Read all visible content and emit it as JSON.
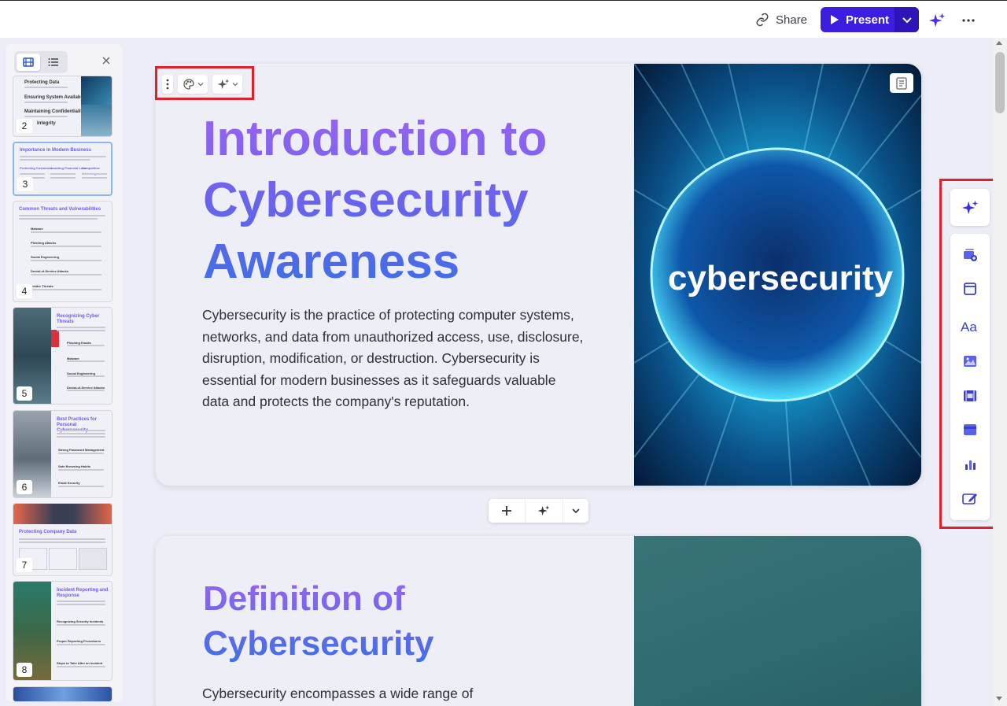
{
  "topbar": {
    "share_label": "Share",
    "present_label": "Present",
    "icons": [
      "link-icon",
      "play-icon",
      "chevron-down-icon",
      "sparkle-icon",
      "more-horizontal-icon"
    ]
  },
  "colors": {
    "accent": "#3b1ee0",
    "heading_gradient_start": "#9a63f2",
    "heading_gradient_end": "#3d6fe6",
    "highlight_box": "#e0202a"
  },
  "left_panel": {
    "views": [
      "filmstrip-view",
      "outline-view"
    ],
    "active_view": "filmstrip-view",
    "slides": [
      {
        "number": "2",
        "title": "",
        "items": [
          "Protecting Data",
          "Ensuring System Availability",
          "Maintaining Confidentiality",
          "Integrity"
        ]
      },
      {
        "number": "3",
        "title": "Importance in Modern Business",
        "columns": [
          "Protecting Customers",
          "Avoiding Financial Loss",
          "Competitive Advantage"
        ],
        "selected": true
      },
      {
        "number": "4",
        "title": "Common Threats and Vulnerabilities",
        "items": [
          "Malware",
          "Phishing Attacks",
          "Social Engineering",
          "Denial-of-Service Attacks",
          "Insider Threats"
        ]
      },
      {
        "number": "5",
        "title": "Recognizing Cyber Threats",
        "items": [
          "Phishing Emails",
          "Malware",
          "Social Engineering",
          "Denial-of-Service Attacks"
        ]
      },
      {
        "number": "6",
        "title": "Best Practices for Personal Cybersecurity",
        "items": [
          "Strong Password Management",
          "Safe Browsing Habits",
          "Email Security"
        ]
      },
      {
        "number": "7",
        "title": "Protecting Company Data"
      },
      {
        "number": "8",
        "title": "Incident Reporting and Response",
        "items": [
          "Recognizing Security Incidents",
          "Proper Reporting Procedures",
          "Steps to Take After an Incident"
        ]
      }
    ]
  },
  "card1": {
    "toolbar_icons": [
      "more-vertical-icon",
      "palette-icon",
      "sparkle-icon"
    ],
    "heading": "Introduction to Cybersecurity Awareness",
    "body": "Cybersecurity is the practice of protecting computer systems, networks, and data from unauthorized access, use, disclosure, disruption, modification, or destruction. Cybersecurity is essential for modern businesses as it safeguards valuable data and protects the company's reputation.",
    "image_text": "cybersecurity"
  },
  "add_bar": {
    "icons": [
      "plus-icon",
      "sparkle-icon",
      "chevron-down-icon"
    ]
  },
  "card2": {
    "heading": "Definition of Cybersecurity",
    "body": "Cybersecurity encompasses a wide range of"
  },
  "right_toolbar": {
    "items": [
      "ai-sparkle",
      "add-card",
      "layout",
      "text-styles",
      "image",
      "video",
      "embed",
      "chart",
      "edit"
    ]
  }
}
